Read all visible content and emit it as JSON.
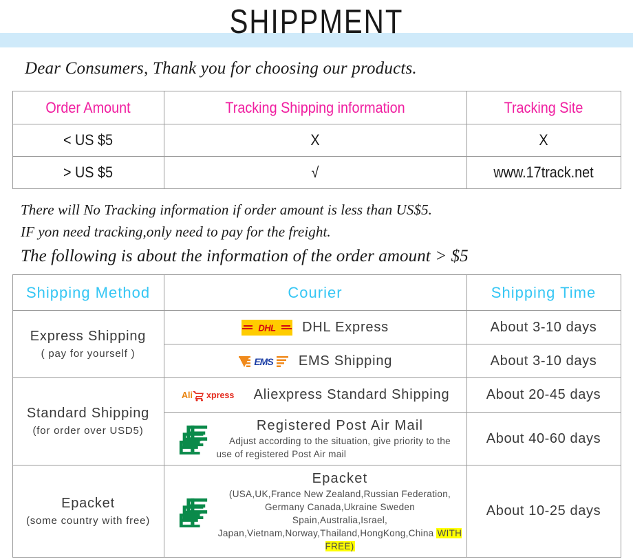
{
  "header": {
    "title": "SHIPPMENT",
    "band_color": "#cfeafa"
  },
  "greeting": "Dear Consumers, Thank you for choosing our products.",
  "tracking_table": {
    "header_color": "#f01ea0",
    "columns": [
      "Order Amount",
      "Tracking Shipping information",
      "Tracking Site"
    ],
    "rows": [
      {
        "amount": "< US $5",
        "tracking": "X",
        "site": "X"
      },
      {
        "amount": "> US $5",
        "tracking": "√",
        "site": "www.17track.net"
      }
    ]
  },
  "notes": [
    "There will No Tracking information if order amount is less than US$5.",
    "IF yon need tracking,only need to pay for the freight.",
    "The following is about the information of the order amount > $5"
  ],
  "shipping_table": {
    "header_color": "#35c6f4",
    "columns": [
      "Shipping  Method",
      "Courier",
      "Shipping  Time"
    ],
    "methods": [
      {
        "name": "Express Shipping",
        "sub": "( pay for yourself )"
      },
      {
        "name": "Standard Shipping",
        "sub": "(for order over USD5)"
      },
      {
        "name": "Epacket",
        "sub": "(some country with free)"
      }
    ],
    "rows": [
      {
        "logo": "dhl-logo",
        "courier": "DHL  Express",
        "time": "About  3-10  days"
      },
      {
        "logo": "ems-logo",
        "courier": "EMS  Shipping",
        "time": "About  3-10  days"
      },
      {
        "logo": "aliexpress-logo",
        "courier": "Aliexpress  Standard  Shipping",
        "time": "About  20-45  days"
      },
      {
        "logo": "china-post-logo",
        "courier": "Registered  Post  Air  Mail",
        "desc_line1": "Adjust  according  to  the  situation,  give  priority  to  the",
        "desc_line2": "use  of  registered  Post  Air  mail",
        "time": "About  40-60  days"
      },
      {
        "logo": "china-post-logo",
        "courier": "Epacket",
        "desc_line1": "(USA,UK,France  New  Zealand,Russian  Federation,",
        "desc_line2": "Germany  Canada,Ukraine  Sweden  Spain,Australia,Israel,",
        "desc_line3_pre": "Japan,Vietnam,Norway,Thailand,HongKong,China ",
        "desc_line3_hl": "WITH  FREE)",
        "time": "About  10-25  days"
      }
    ]
  }
}
